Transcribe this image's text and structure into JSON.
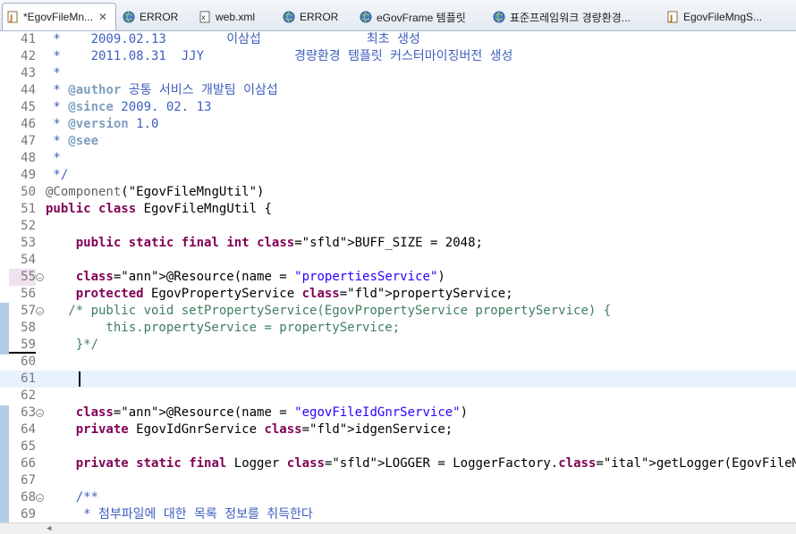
{
  "tabs": [
    {
      "label": "*EgovFileMn...",
      "icon": "java-file-icon",
      "active": true,
      "close": "✕"
    },
    {
      "label": "ERROR",
      "icon": "globe-icon"
    },
    {
      "label": "web.xml",
      "icon": "xml-file-icon"
    },
    {
      "label": "ERROR",
      "icon": "globe-icon"
    },
    {
      "label": "eGovFrame 템플릿",
      "icon": "globe-icon"
    },
    {
      "label": "표준프레임워크 경량환경...",
      "icon": "globe-icon"
    },
    {
      "label": "EgovFileMngS...",
      "icon": "java-file-icon"
    }
  ],
  "editor": {
    "current_line": 61,
    "lines": [
      {
        "n": 41,
        "text": " *    2009.02.13        이삼섭              최초 생성"
      },
      {
        "n": 42,
        "text": " *    2011.08.31  JJY            경량환경 템플릿 커스터마이징버전 생성"
      },
      {
        "n": 43,
        "text": " *"
      },
      {
        "n": 44,
        "tag": "@author",
        "text": " 공통 서비스 개발팀 이삼섭"
      },
      {
        "n": 45,
        "tag": "@since",
        "text": " 2009. 02. 13"
      },
      {
        "n": 46,
        "tag": "@version",
        "text": " 1.0"
      },
      {
        "n": 47,
        "tag": "@see",
        "text": ""
      },
      {
        "n": 48,
        "text": " *"
      },
      {
        "n": 49,
        "text": " */"
      },
      {
        "n": 50,
        "ann": "@Component",
        "text": "(\"EgovFileMngUtil\")"
      },
      {
        "n": 51,
        "text": "public class EgovFileMngUtil {"
      },
      {
        "n": 52,
        "text": ""
      },
      {
        "n": 53,
        "text": "    public static final int BUFF_SIZE = 2048;"
      },
      {
        "n": 54,
        "text": ""
      },
      {
        "n": 55,
        "text": "    @Resource(name = \"propertiesService\")"
      },
      {
        "n": 56,
        "text": "    protected EgovPropertyService propertyService;"
      },
      {
        "n": 57,
        "text": "   /* public void setPropertyService(EgovPropertyService propertyService) {"
      },
      {
        "n": 58,
        "text": "        this.propertyService = propertyService;"
      },
      {
        "n": 59,
        "text": "    }*/"
      },
      {
        "n": 60,
        "text": ""
      },
      {
        "n": 61,
        "text": ""
      },
      {
        "n": 62,
        "text": ""
      },
      {
        "n": 63,
        "text": "    @Resource(name = \"egovFileIdGnrService\")"
      },
      {
        "n": 64,
        "text": "    private EgovIdGnrService idgenService;"
      },
      {
        "n": 65,
        "text": ""
      },
      {
        "n": 66,
        "text": "    private static final Logger LOGGER = LoggerFactory.getLogger(EgovFileMngUtil.class);"
      },
      {
        "n": 67,
        "text": ""
      },
      {
        "n": 68,
        "text": "    /**"
      },
      {
        "n": 69,
        "text": "     * 첨부파일에 대한 목록 정보를 취득한다"
      }
    ]
  }
}
